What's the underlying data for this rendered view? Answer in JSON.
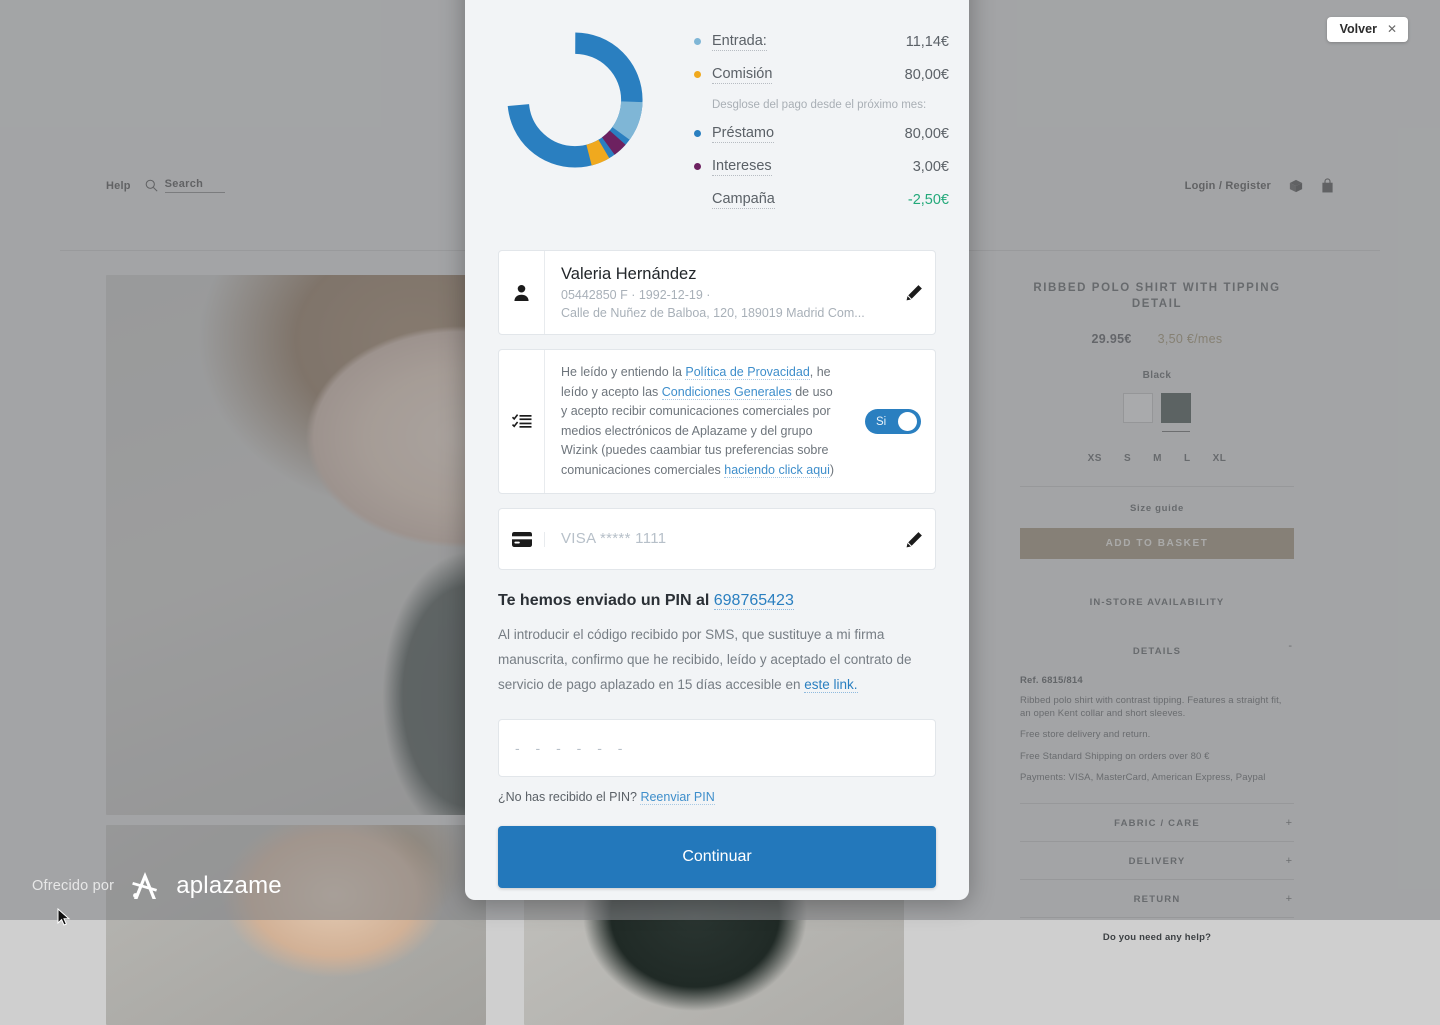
{
  "overlay": {
    "back_button": {
      "label": "Volver",
      "close_icon": "close-icon"
    },
    "brand": {
      "prefix": "Ofrecido por",
      "name": "aplazame",
      "logo_icon": "aplazame-star-icon"
    }
  },
  "modal": {
    "summary": {
      "rows": [
        {
          "name": "Entrada:",
          "value": "11,14€",
          "color": "#7fb6d6"
        },
        {
          "name": "Comisión",
          "value": "80,00€",
          "color": "#f0a91e"
        }
      ],
      "subtitle": "Desglose del pago desde el próximo mes:",
      "rows2": [
        {
          "name": "Préstamo",
          "value": "80,00€",
          "color": "#2a7fc0"
        },
        {
          "name": "Intereses",
          "value": "3,00€",
          "color": "#6d2160"
        },
        {
          "name": "Campaña",
          "value": "-2,50€",
          "color": "",
          "value_color": "#23a97a"
        }
      ]
    },
    "customer": {
      "icon": "person-icon",
      "name": "Valeria Hernández",
      "meta_line1": "05442850 F  ·  1992-12-19  ·",
      "meta_line2": "Calle de Nuñez de Balboa, 120, 189019 Madrid Com...",
      "edit_icon": "pencil-icon"
    },
    "consent": {
      "icon": "checklist-icon",
      "text_1": "He leído y entiendo la ",
      "link_1": "Política de Provacidad",
      "text_2": ", he leído y acepto las ",
      "link_2": "Condiciones Generales",
      "text_3": " de uso y acepto recibir comunicaciones comerciales por medios electrónicos de Aplazame y del grupo Wizink (puedes caambiar tus preferencias sobre comunicaciones comerciales ",
      "link_3": "haciendo click aqui",
      "text_4": ")",
      "toggle_label": "Si",
      "toggle_on": true
    },
    "payment": {
      "icon": "credit-card-icon",
      "card_text": "VISA ***** 1111",
      "edit_icon": "pencil-icon"
    },
    "pin": {
      "heading_prefix": "Te hemos enviado un PIN al ",
      "phone": "698765423",
      "description_1": "Al introducir el código recibido por SMS, que sustituye a mi firma manuscrita, confirmo que he recibido, leído y aceptado el contrato de servicio de pago aplazado en 15 días accesible en ",
      "link_label": "este link.",
      "input_placeholder": "- - - - - -",
      "input_value": "",
      "resend_question": "¿No has recibido el PIN?",
      "resend_link": "Reenviar PIN"
    },
    "submit_label": "Continuar"
  },
  "merchant": {
    "header": {
      "help": "Help",
      "search_label": "Search",
      "search_icon": "search-icon",
      "login": "Login / Register",
      "package_icon": "package-icon",
      "bag_icon": "shopping-bag-icon"
    },
    "product": {
      "title": "RIBBED POLO SHIRT WITH TIPPING DETAIL",
      "price": "29.95€",
      "monthly": "3,50 €/mes",
      "color_label": "Black",
      "swatches": [
        {
          "name": "white-swatch",
          "hex": "#e6e6e6",
          "selected": false
        },
        {
          "name": "black-swatch",
          "hex": "#1e2d29",
          "selected": true
        }
      ],
      "sizes": [
        "XS",
        "S",
        "M",
        "L",
        "XL"
      ],
      "size_guide": "Size guide",
      "add_to_basket": "ADD TO BASKET",
      "in_store": "IN-STORE AVAILABILITY",
      "details_title": "DETAILS",
      "details_sign": "-",
      "ref": "Ref. 6815/814",
      "details_lines": [
        "Ribbed polo shirt with contrast tipping. Features a straight fit, an open Kent collar and short sleeves.",
        "Free store delivery and return.",
        "Free Standard Shipping on orders over 80 €",
        "Payments: VISA, MasterCard, American Express, Paypal"
      ],
      "accordions": [
        {
          "label": "FABRIC / CARE",
          "sign": "+"
        },
        {
          "label": "DELIVERY",
          "sign": "+"
        },
        {
          "label": "RETURN",
          "sign": "+"
        }
      ],
      "help_text": "Do you need any help?"
    }
  },
  "chart_data": {
    "type": "pie",
    "title": "Desglose del pago",
    "categories": [
      "Préstamo",
      "Entrada",
      "Intereses",
      "Comisión"
    ],
    "values": [
      75,
      11,
      5,
      6
    ],
    "colors": [
      "#2a7fc0",
      "#7fb6d6",
      "#6d2160",
      "#f0a91e"
    ],
    "labels": [
      "80,00€",
      "11,14€",
      "3,00€",
      "80,00€"
    ],
    "legend": "right",
    "donut": true
  }
}
